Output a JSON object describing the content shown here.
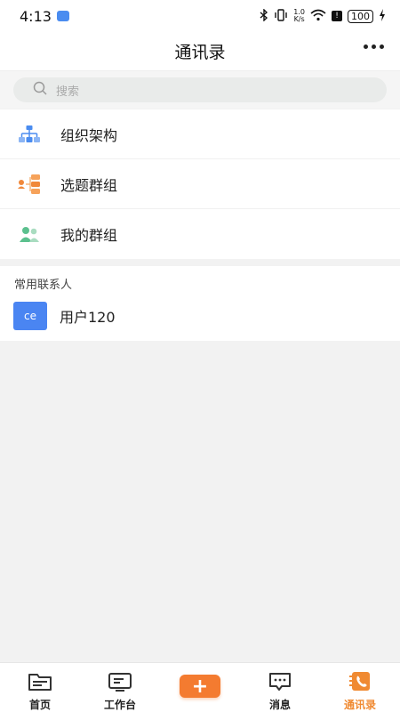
{
  "status_bar": {
    "time": "4:13",
    "net_speed_top": "1.0",
    "net_speed_bottom": "K/s",
    "battery": "100"
  },
  "header": {
    "title": "通讯录"
  },
  "search": {
    "placeholder": "搜索"
  },
  "menu": {
    "items": [
      {
        "label": "组织架构",
        "icon": "org-chart-icon"
      },
      {
        "label": "选题群组",
        "icon": "topic-group-icon"
      },
      {
        "label": "我的群组",
        "icon": "my-group-icon"
      }
    ]
  },
  "contacts": {
    "section_title": "常用联系人",
    "items": [
      {
        "avatar_text": "ce",
        "name": "用户120"
      }
    ]
  },
  "tabbar": {
    "tabs": [
      {
        "label": "首页"
      },
      {
        "label": "工作台"
      },
      {
        "label": "+"
      },
      {
        "label": "消息"
      },
      {
        "label": "通讯录"
      }
    ],
    "active": "通讯录"
  },
  "colors": {
    "accent": "#f47b30",
    "active_tab": "#f08a32",
    "avatar_bg": "#4a85f2",
    "org_icon": "#4a8cf0",
    "group_icon": "#5cc08e"
  }
}
